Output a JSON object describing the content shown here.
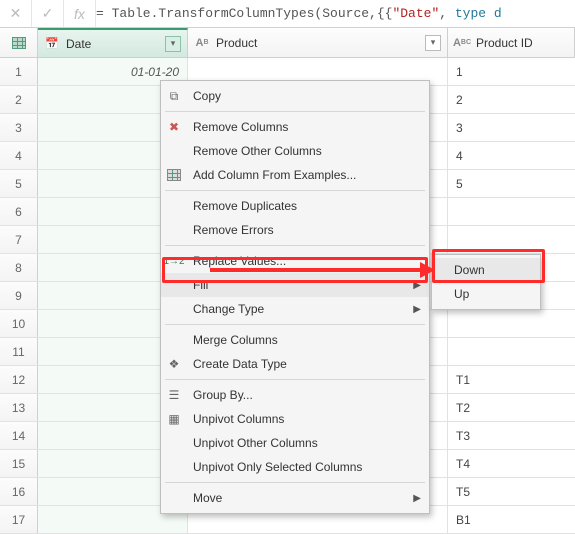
{
  "formula": {
    "prefix": "= Table.TransformColumnTypes(Source,{{",
    "str": "\"Date\"",
    "sep": ", ",
    "kw": "type d"
  },
  "columns": {
    "date": "Date",
    "product": "Product",
    "product_id": "Product ID"
  },
  "rows": [
    {
      "n": "1",
      "date": "01-01-20",
      "pid": "1"
    },
    {
      "n": "2",
      "date": "",
      "pid": "2"
    },
    {
      "n": "3",
      "date": "",
      "pid": "3"
    },
    {
      "n": "4",
      "date": "",
      "pid": "4"
    },
    {
      "n": "5",
      "date": "",
      "pid": "5"
    },
    {
      "n": "6",
      "date": "",
      "pid": ""
    },
    {
      "n": "7",
      "date": "",
      "pid": ""
    },
    {
      "n": "8",
      "date": "",
      "pid": ""
    },
    {
      "n": "9",
      "date": "",
      "pid": ""
    },
    {
      "n": "10",
      "date": "",
      "pid": ""
    },
    {
      "n": "11",
      "date": "",
      "pid": ""
    },
    {
      "n": "12",
      "date": "",
      "pid": "T1"
    },
    {
      "n": "13",
      "date": "",
      "pid": "T2"
    },
    {
      "n": "14",
      "date": "",
      "pid": "T3"
    },
    {
      "n": "15",
      "date": "",
      "pid": "T4"
    },
    {
      "n": "16",
      "date": "",
      "pid": "T5"
    },
    {
      "n": "17",
      "date": "",
      "pid": "B1"
    }
  ],
  "menu": {
    "copy": "Copy",
    "remove_cols": "Remove Columns",
    "remove_other": "Remove Other Columns",
    "add_col_ex": "Add Column From Examples...",
    "remove_dup": "Remove Duplicates",
    "remove_err": "Remove Errors",
    "replace_vals": "Replace Values...",
    "fill": "Fill",
    "change_type": "Change Type",
    "merge_cols": "Merge Columns",
    "create_dt": "Create Data Type",
    "group_by": "Group By...",
    "unpivot": "Unpivot Columns",
    "unpivot_other": "Unpivot Other Columns",
    "unpivot_sel": "Unpivot Only Selected Columns",
    "move": "Move"
  },
  "submenu": {
    "down": "Down",
    "up": "Up"
  }
}
